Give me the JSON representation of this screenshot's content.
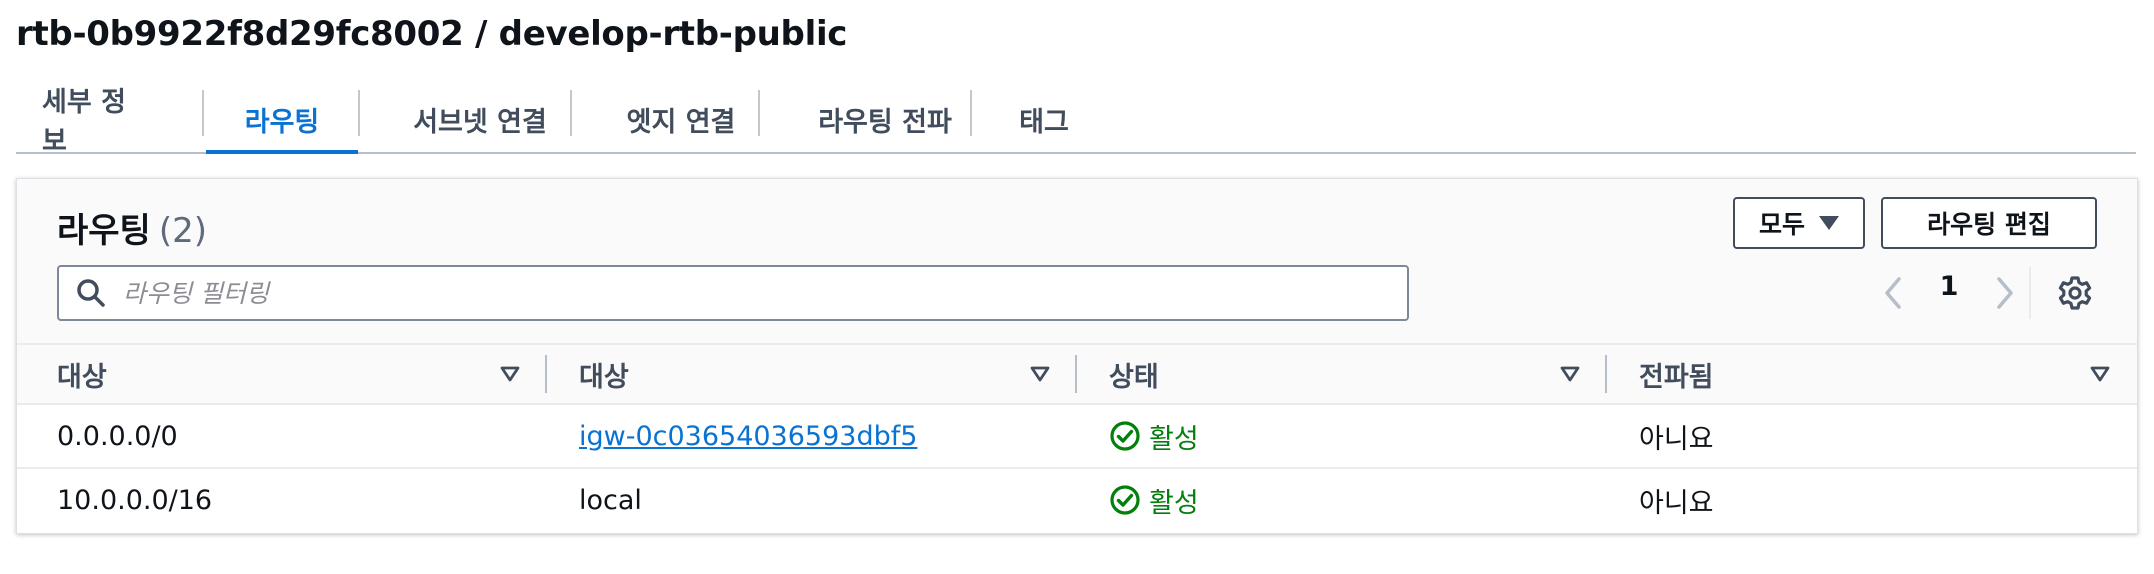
{
  "page": {
    "title": "rtb-0b9922f8d29fc8002 / develop-rtb-public"
  },
  "tabs": [
    {
      "label": "세부 정보"
    },
    {
      "label": "라우팅"
    },
    {
      "label": "서브넷 연결"
    },
    {
      "label": "엣지 연결"
    },
    {
      "label": "라우팅 전파"
    },
    {
      "label": "태그"
    }
  ],
  "active_tab": "라우팅",
  "panel": {
    "title": "라우팅",
    "count": "(2)",
    "filter_button": "모두",
    "edit_button": "라우팅 편집",
    "search_placeholder": "라우팅 필터링",
    "pagination": {
      "current_page": "1"
    }
  },
  "table": {
    "columns": [
      "대상",
      "대상",
      "상태",
      "전파됨"
    ],
    "rows": [
      {
        "destination": "0.0.0.0/0",
        "target": "igw-0c03654036593dbf5",
        "target_is_link": true,
        "status": "활성",
        "propagated": "아니요"
      },
      {
        "destination": "10.0.0.0/16",
        "target": "local",
        "target_is_link": false,
        "status": "활성",
        "propagated": "아니요"
      }
    ]
  },
  "colors": {
    "accent": "#0972d3",
    "success": "#037f0c",
    "text": "#0f141a",
    "muted": "#414d5c"
  }
}
